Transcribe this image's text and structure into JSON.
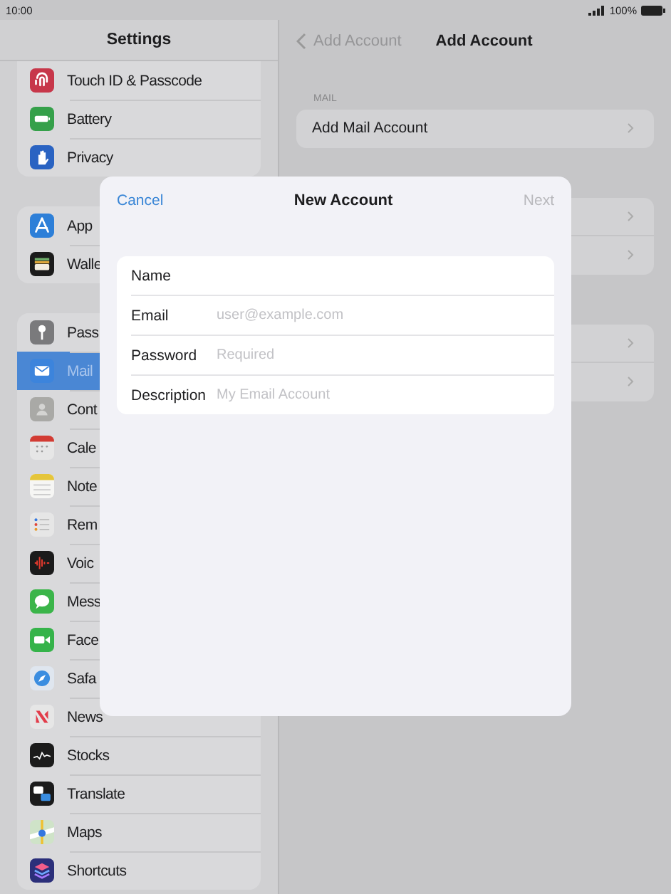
{
  "status_bar": {
    "time": "10:00",
    "battery": "100%"
  },
  "sidebar": {
    "title": "Settings",
    "groups": [
      {
        "items": [
          {
            "label": "Touch ID & Passcode",
            "color": "#c7374a",
            "selected": false
          },
          {
            "label": "Battery",
            "color": "#35a04a",
            "selected": false
          },
          {
            "label": "Privacy",
            "color": "#2a63c2",
            "selected": false
          }
        ]
      },
      {
        "items": [
          {
            "label": "App",
            "color": "#2d7fd8",
            "selected": false
          },
          {
            "label": "Walle",
            "color": "#1b1b1b",
            "selected": false
          }
        ]
      },
      {
        "items": [
          {
            "label": "Pass",
            "color": "#7a7a7c",
            "selected": false
          },
          {
            "label": "Mail",
            "color": "#3c84dc",
            "selected": true
          },
          {
            "label": "Cont",
            "color": "#a9a9a6",
            "selected": false
          },
          {
            "label": "Cale",
            "color": "#e6e6e6",
            "selected": false
          },
          {
            "label": "Note",
            "color": "#f6f6f4",
            "selected": false
          },
          {
            "label": "Rem",
            "color": "#e6e6e6",
            "selected": false
          },
          {
            "label": "Voic",
            "color": "#1b1b1b",
            "selected": false
          },
          {
            "label": "Mess",
            "color": "#3bb54a",
            "selected": false
          },
          {
            "label": "Face",
            "color": "#35b34a",
            "selected": false
          },
          {
            "label": "Safa",
            "color": "#dfe6ef",
            "selected": false
          },
          {
            "label": "News",
            "color": "#e6e6e6",
            "selected": false
          },
          {
            "label": "Stocks",
            "color": "#1b1b1b",
            "selected": false
          },
          {
            "label": "Translate",
            "color": "#1b1b1b",
            "selected": false
          },
          {
            "label": "Maps",
            "color": "#cfe3c8",
            "selected": false
          },
          {
            "label": "Shortcuts",
            "color": "#2b2f7a",
            "selected": false
          }
        ]
      }
    ]
  },
  "detail": {
    "back": "Add Account",
    "title": "Add Account",
    "section_label": "MAIL",
    "rows": [
      {
        "label": "Add Mail Account"
      }
    ]
  },
  "modal": {
    "cancel": "Cancel",
    "title": "New Account",
    "next": {
      "label": "Next",
      "disabled": true
    },
    "fields": [
      {
        "label": "Name"
      },
      {
        "label": "Email",
        "placeholder": "user@example.com"
      },
      {
        "label": "Password",
        "placeholder": "Required"
      },
      {
        "label": "Description",
        "placeholder": "My Email Account"
      }
    ]
  }
}
